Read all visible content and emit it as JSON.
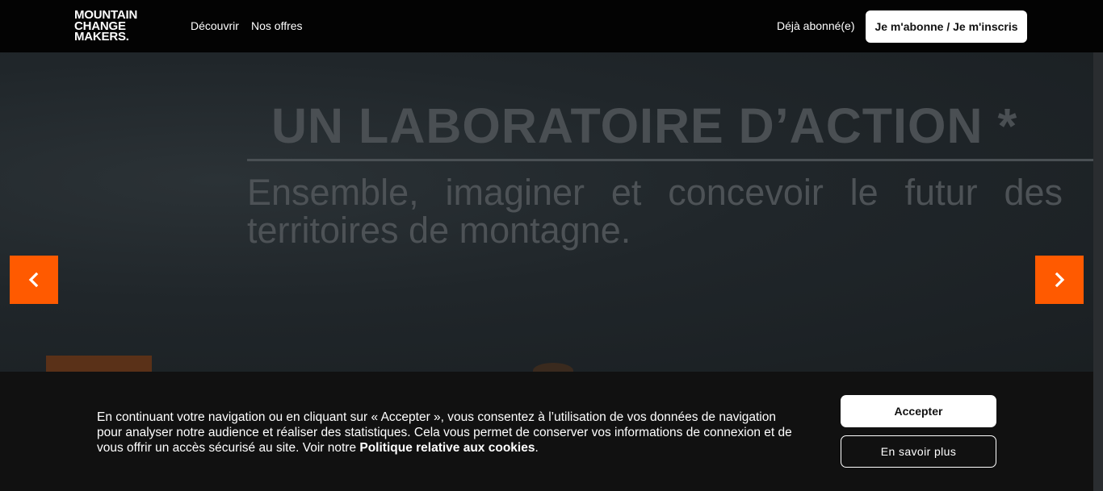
{
  "header": {
    "logo_lines": [
      "MOUNTAIN",
      "CHANGE",
      "MAKERS."
    ],
    "nav": [
      {
        "label": "Découvrir"
      },
      {
        "label": "Nos offres"
      }
    ],
    "login_label": "Déjà abonné(e)",
    "subscribe_label": "Je m'abonne / Je m'inscris"
  },
  "hero": {
    "title": "UN LABORATOIRE D’ACTION *",
    "subtitle": "Ensemble, imaginer et concevoir le futur des territoires de montagne.",
    "prev_icon": "chevron-left-icon",
    "next_icon": "chevron-right-icon",
    "accent_color": "#ff5a00"
  },
  "cookie": {
    "text_before": "En continuant votre navigation ou en cliquant sur « Accepter », vous consentez à l’utilisation de vos données de navigation pour analyser notre audience et réaliser des statistiques. Cela vous permet de conserver vos informations de connexion et de vous offrir un accès sécurisé au site. Voir notre ",
    "policy_link": "Politique relative aux cookies",
    "text_after": ".",
    "accept_label": "Accepter",
    "more_label": "En savoir plus"
  }
}
